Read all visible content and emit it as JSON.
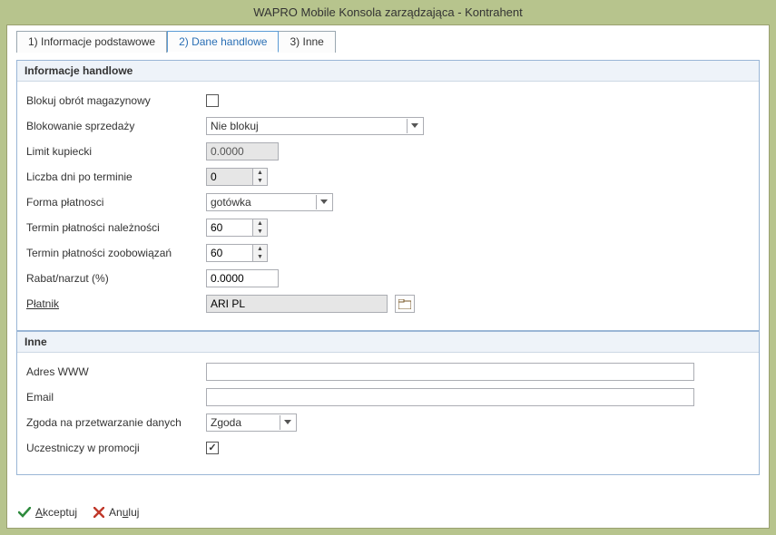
{
  "window": {
    "title": "WAPRO Mobile Konsola zarządzająca - Kontrahent"
  },
  "tabs": {
    "t1": "1) Informacje podstawowe",
    "t2": "2) Dane handlowe",
    "t3": "3) Inne"
  },
  "group1": {
    "title": "Informacje handlowe",
    "blokuj_label": "Blokuj obrót magazynowy",
    "blokuj_checked": "",
    "blok_sprz_label": "Blokowanie sprzedaży",
    "blok_sprz_value": "Nie blokuj",
    "limit_label": "Limit kupiecki",
    "limit_value": "0.0000",
    "liczba_label": "Liczba dni po terminie",
    "liczba_value": "0",
    "forma_label": "Forma płatnosci",
    "forma_value": "gotówka",
    "term_nal_label": "Termin płatności należności",
    "term_nal_value": "60",
    "term_zob_label": "Termin płatności zoobowiązań",
    "term_zob_value": "60",
    "rabat_label": "Rabat/narzut (%)",
    "rabat_value": "0.0000",
    "platnik_label": "Płatnik",
    "platnik_value": "ARI PL"
  },
  "group2": {
    "title": "Inne",
    "www_label": "Adres WWW",
    "www_value": "",
    "email_label": "Email",
    "email_value": "",
    "zgoda_label": "Zgoda na przetwarzanie danych",
    "zgoda_value": "Zgoda",
    "ucz_label": "Uczestniczy w promocji",
    "ucz_checked": "✓"
  },
  "footer": {
    "ok": "Akceptuj",
    "cancel": "Anuluj"
  }
}
